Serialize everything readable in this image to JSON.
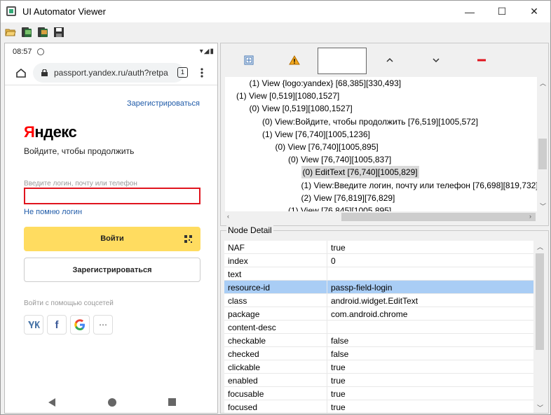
{
  "window": {
    "title": "UI Automator Viewer",
    "controls": {
      "minimize": "—",
      "maximize": "☐",
      "close": "✕"
    }
  },
  "toolbar": {
    "icons": [
      "open-folder-icon",
      "device-screenshot-icon",
      "device-screenshot-compressed-icon",
      "save-icon"
    ]
  },
  "phone": {
    "status": {
      "time": "08:57",
      "right": "▾◢▮"
    },
    "browser": {
      "url": "passport.yandex.ru/auth?retpa",
      "tabs_count": "1"
    },
    "page": {
      "register_link": "Зарегистрироваться",
      "logo_first": "Я",
      "logo_rest": "ндекс",
      "subtitle": "Войдите, чтобы продолжить",
      "login_label": "Введите логин, почту или телефон",
      "forgot_link": "Не помню логин",
      "login_button": "Войти",
      "register_button": "Зарегистрироваться",
      "social_label": "Войти с помощью соцсетей",
      "social": [
        "vk-icon",
        "facebook-icon",
        "google-icon",
        "more-icon"
      ]
    }
  },
  "hierarchy": {
    "toolbar_icons": [
      "expand-all-icon",
      "warning-icon",
      "toggle-naf-box",
      "chevron-up-icon",
      "chevron-down-icon",
      "collapse-icon"
    ],
    "rows": [
      {
        "text": "(1) View {logo:yandex} [68,385][330,493]",
        "level": 1,
        "selected": false
      },
      {
        "text": "(1) View [0,519][1080,1527]",
        "level": 0,
        "selected": false
      },
      {
        "text": "(0) View [0,519][1080,1527]",
        "level": 1,
        "selected": false
      },
      {
        "text": "(0) View:Войдите, чтобы продолжить [76,519][1005,572]",
        "level": 2,
        "selected": false
      },
      {
        "text": "(1) View [76,740][1005,1236]",
        "level": 2,
        "selected": false
      },
      {
        "text": "(0) View [76,740][1005,895]",
        "level": 3,
        "selected": false
      },
      {
        "text": "(0) View [76,740][1005,837]",
        "level": 4,
        "selected": false
      },
      {
        "text": "(0) EditText [76,740][1005,829]",
        "level": 5,
        "selected": true
      },
      {
        "text": "(1) View:Введите логин, почту или телефон [76,698][819,732]",
        "level": 5,
        "selected": false
      },
      {
        "text": "(2) View [76,819][76,829]",
        "level": 5,
        "selected": false
      },
      {
        "text": "(1) View [76,845][1005,895]",
        "level": 4,
        "selected": false
      }
    ]
  },
  "node_detail": {
    "title": "Node Detail",
    "rows": [
      {
        "key": "NAF",
        "value": "true",
        "selected": false
      },
      {
        "key": "index",
        "value": "0",
        "selected": false
      },
      {
        "key": "text",
        "value": "",
        "selected": false
      },
      {
        "key": "resource-id",
        "value": "passp-field-login",
        "selected": true
      },
      {
        "key": "class",
        "value": "android.widget.EditText",
        "selected": false
      },
      {
        "key": "package",
        "value": "com.android.chrome",
        "selected": false
      },
      {
        "key": "content-desc",
        "value": "",
        "selected": false
      },
      {
        "key": "checkable",
        "value": "false",
        "selected": false
      },
      {
        "key": "checked",
        "value": "false",
        "selected": false
      },
      {
        "key": "clickable",
        "value": "true",
        "selected": false
      },
      {
        "key": "enabled",
        "value": "true",
        "selected": false
      },
      {
        "key": "focusable",
        "value": "true",
        "selected": false
      },
      {
        "key": "focused",
        "value": "true",
        "selected": false
      }
    ]
  }
}
